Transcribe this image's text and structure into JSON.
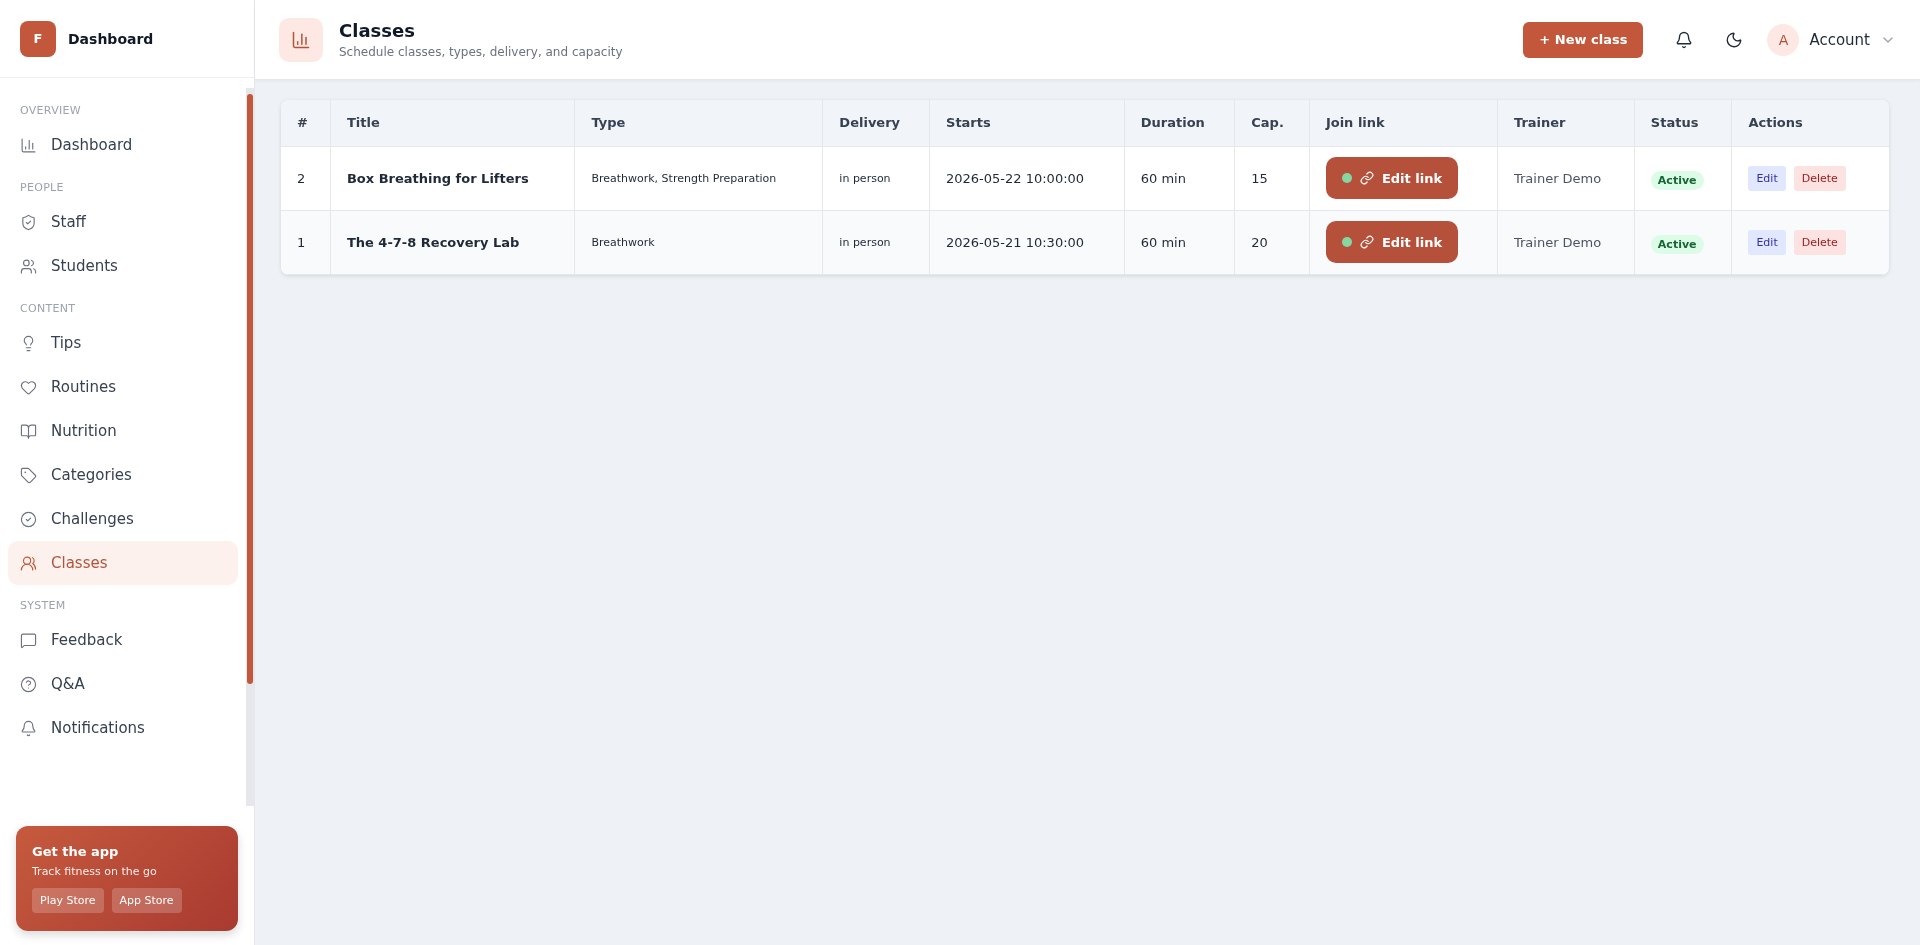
{
  "brand": {
    "logo": "F",
    "title": "Dashboard"
  },
  "sidebar": {
    "sections": [
      {
        "label": "OVERVIEW",
        "items": [
          {
            "label": "Dashboard",
            "selected": false
          }
        ]
      },
      {
        "label": "PEOPLE",
        "items": [
          {
            "label": "Staff",
            "selected": false
          },
          {
            "label": "Students",
            "selected": false
          }
        ]
      },
      {
        "label": "CONTENT",
        "items": [
          {
            "label": "Tips",
            "selected": false
          },
          {
            "label": "Routines",
            "selected": false
          },
          {
            "label": "Nutrition",
            "selected": false
          },
          {
            "label": "Categories",
            "selected": false
          },
          {
            "label": "Challenges",
            "selected": false
          },
          {
            "label": "Classes",
            "selected": true
          }
        ]
      },
      {
        "label": "SYSTEM",
        "items": [
          {
            "label": "Feedback",
            "selected": false
          },
          {
            "label": "Q&A",
            "selected": false
          },
          {
            "label": "Notifications",
            "selected": false
          }
        ]
      }
    ]
  },
  "promo": {
    "title": "Get the app",
    "text": "Track fitness on the go",
    "buttons": [
      "Play Store",
      "App Store"
    ]
  },
  "header": {
    "title": "Classes",
    "subtitle": "Schedule classes, types, delivery, and capacity",
    "new_button": "+ New class",
    "account": {
      "initial": "A",
      "label": "Account"
    }
  },
  "table": {
    "columns": [
      "#",
      "Title",
      "Type",
      "Delivery",
      "Starts",
      "Duration",
      "Cap.",
      "Join link",
      "Trainer",
      "Status",
      "Actions"
    ],
    "rows": [
      {
        "num": "2",
        "title": "Box Breathing for Lifters",
        "type": "Breathwork, Strength Preparation",
        "delivery": "in person",
        "starts": "2026-05-22 10:00:00",
        "duration": "60 min",
        "cap": "15",
        "join": "Edit link",
        "trainer": "Trainer Demo",
        "status": "Active",
        "actions": [
          "Edit",
          "Delete"
        ]
      },
      {
        "num": "1",
        "title": "The 4-7-8 Recovery Lab",
        "type": "Breathwork",
        "delivery": "in person",
        "starts": "2026-05-21 10:30:00",
        "duration": "60 min",
        "cap": "20",
        "join": "Edit link",
        "trainer": "Trainer Demo",
        "status": "Active",
        "actions": [
          "Edit",
          "Delete"
        ]
      }
    ]
  }
}
